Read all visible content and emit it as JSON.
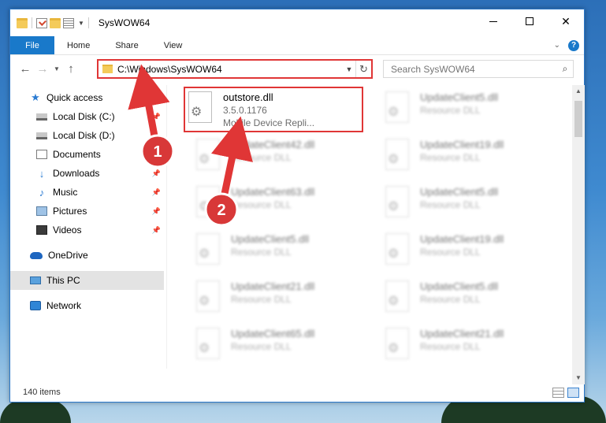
{
  "window": {
    "title": "SysWOW64"
  },
  "ribbon": {
    "tabs": [
      {
        "label": "File"
      },
      {
        "label": "Home"
      },
      {
        "label": "Share"
      },
      {
        "label": "View"
      }
    ],
    "help_label": "?"
  },
  "navigation": {
    "address_path": "C:\\Windows\\SysWOW64",
    "search_placeholder": "Search SysWOW64"
  },
  "sidebar": {
    "items": [
      {
        "label": "Quick access",
        "icon": "star-icon",
        "pinned": false
      },
      {
        "label": "Local Disk (C:)",
        "icon": "drive-icon",
        "pinned": true
      },
      {
        "label": "Local Disk (D:)",
        "icon": "drive-icon",
        "pinned": false
      },
      {
        "label": "Documents",
        "icon": "documents-icon",
        "pinned": true
      },
      {
        "label": "Downloads",
        "icon": "download-icon",
        "pinned": true
      },
      {
        "label": "Music",
        "icon": "music-icon",
        "pinned": true
      },
      {
        "label": "Pictures",
        "icon": "pictures-icon",
        "pinned": true
      },
      {
        "label": "Videos",
        "icon": "videos-icon",
        "pinned": true
      },
      {
        "label": "OneDrive",
        "icon": "onedrive-icon",
        "pinned": false
      },
      {
        "label": "This PC",
        "icon": "this-pc-icon",
        "pinned": false,
        "selected": true
      },
      {
        "label": "Network",
        "icon": "network-icon",
        "pinned": false
      }
    ]
  },
  "files": [
    {
      "name": "outstore.dll",
      "version": "3.5.0.1176",
      "description": "Mobile Device Repli...",
      "highlighted": true
    },
    {
      "name": "UpdateClient5.dll",
      "description": "Resource DLL"
    },
    {
      "name": "UpdateClient42.dll",
      "description": "Resource DLL"
    },
    {
      "name": "UpdateClient19.dll",
      "description": "Resource DLL"
    },
    {
      "name": "UpdateClient63.dll",
      "description": "Resource DLL"
    },
    {
      "name": "UpdateClient5.dll",
      "description": "Resource DLL"
    },
    {
      "name": "UpdateClient5.dll",
      "description": "Resource DLL"
    },
    {
      "name": "UpdateClient19.dll",
      "description": "Resource DLL"
    },
    {
      "name": "UpdateClient21.dll",
      "description": "Resource DLL"
    },
    {
      "name": "UpdateClient5.dll",
      "description": "Resource DLL"
    },
    {
      "name": "UpdateClient65.dll",
      "description": "Resource DLL"
    },
    {
      "name": "UpdateClient21.dll",
      "description": "Resource DLL"
    }
  ],
  "status": {
    "item_count": "140 items"
  },
  "annotations": [
    {
      "label": "1"
    },
    {
      "label": "2"
    }
  ],
  "colors": {
    "accent": "#1979ca",
    "highlight": "#e03636",
    "selected": "#e3e3e3"
  }
}
